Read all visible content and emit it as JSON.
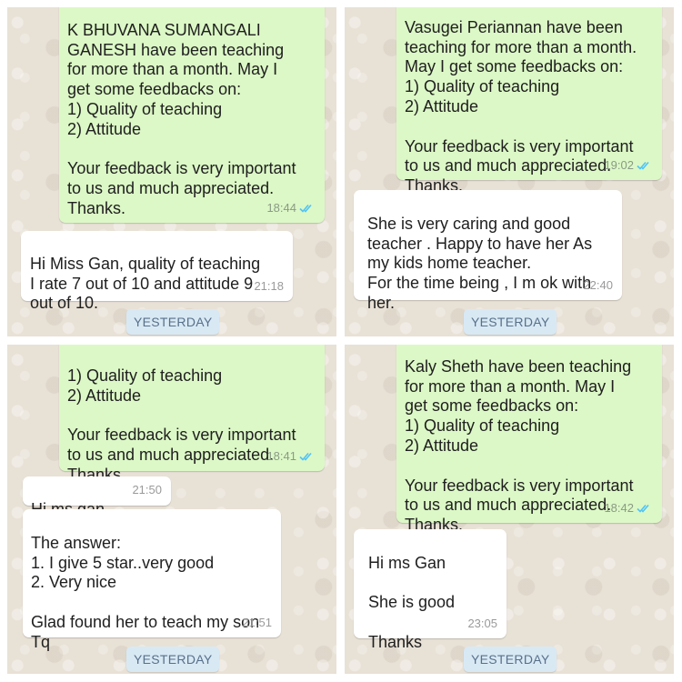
{
  "panels": [
    {
      "messages": [
        {
          "text": "K BHUVANA SUMANGALI\nGANESH have been teaching\nfor more than a month. May I\nget some feedbacks on:\n1) Quality of teaching\n2) Attitude\n\nYour feedback is very important\nto us and much appreciated.\nThanks.",
          "time": "18:44",
          "direction": "outgoing",
          "status": "read"
        },
        {
          "text": "Hi Miss Gan, quality of teaching\nI rate 7 out of 10 and attitude 9\nout of 10.",
          "time": "21:18",
          "direction": "incoming"
        }
      ],
      "date_label": "YESTERDAY"
    },
    {
      "messages": [
        {
          "text": "Vasugei Periannan have been\nteaching for more than a month.\nMay I get some feedbacks on:\n1) Quality of teaching\n2) Attitude\n\nYour feedback is very important\nto us and much appreciated.\nThanks.",
          "time": "19:02",
          "direction": "outgoing",
          "status": "read"
        },
        {
          "text": "She is very caring and good\nteacher . Happy to have her   As\nmy kids home teacher.\nFor the time being , I m ok with\nher.",
          "time": "22:40",
          "direction": "incoming"
        }
      ],
      "date_label": "YESTERDAY"
    },
    {
      "messages": [
        {
          "text": "1) Quality of teaching\n2) Attitude\n\nYour feedback is very important\nto us and much appreciated.\nThanks.",
          "time": "18:41",
          "direction": "outgoing",
          "status": "read"
        },
        {
          "text": "Hi ms gan...",
          "time": "21:50",
          "direction": "incoming"
        },
        {
          "text": "The answer:\n1. I give 5 star..very good\n2. Very nice\n\nGlad found her to teach my son\nTq",
          "time": "21:51",
          "direction": "incoming"
        }
      ],
      "date_label": "YESTERDAY"
    },
    {
      "messages": [
        {
          "text": "Kaly Sheth have been teaching\nfor more than a month. May I\nget some feedbacks on:\n1) Quality of teaching\n2) Attitude\n\nYour feedback is very important\nto us and much appreciated.\nThanks.",
          "time": "18:42",
          "direction": "outgoing",
          "status": "read"
        },
        {
          "text": "Hi ms Gan\n\nShe is good\n\nThanks",
          "time": "23:05",
          "direction": "incoming"
        }
      ],
      "date_label": "YESTERDAY"
    }
  ],
  "colors": {
    "outgoing_bubble": "#dcf8c6",
    "incoming_bubble": "#ffffff",
    "read_tick": "#4fc3f7",
    "date_chip": "#d8e9f4",
    "chat_wallpaper": "#e8e1d6"
  },
  "icons": {
    "read_receipt": "double-check-icon"
  }
}
